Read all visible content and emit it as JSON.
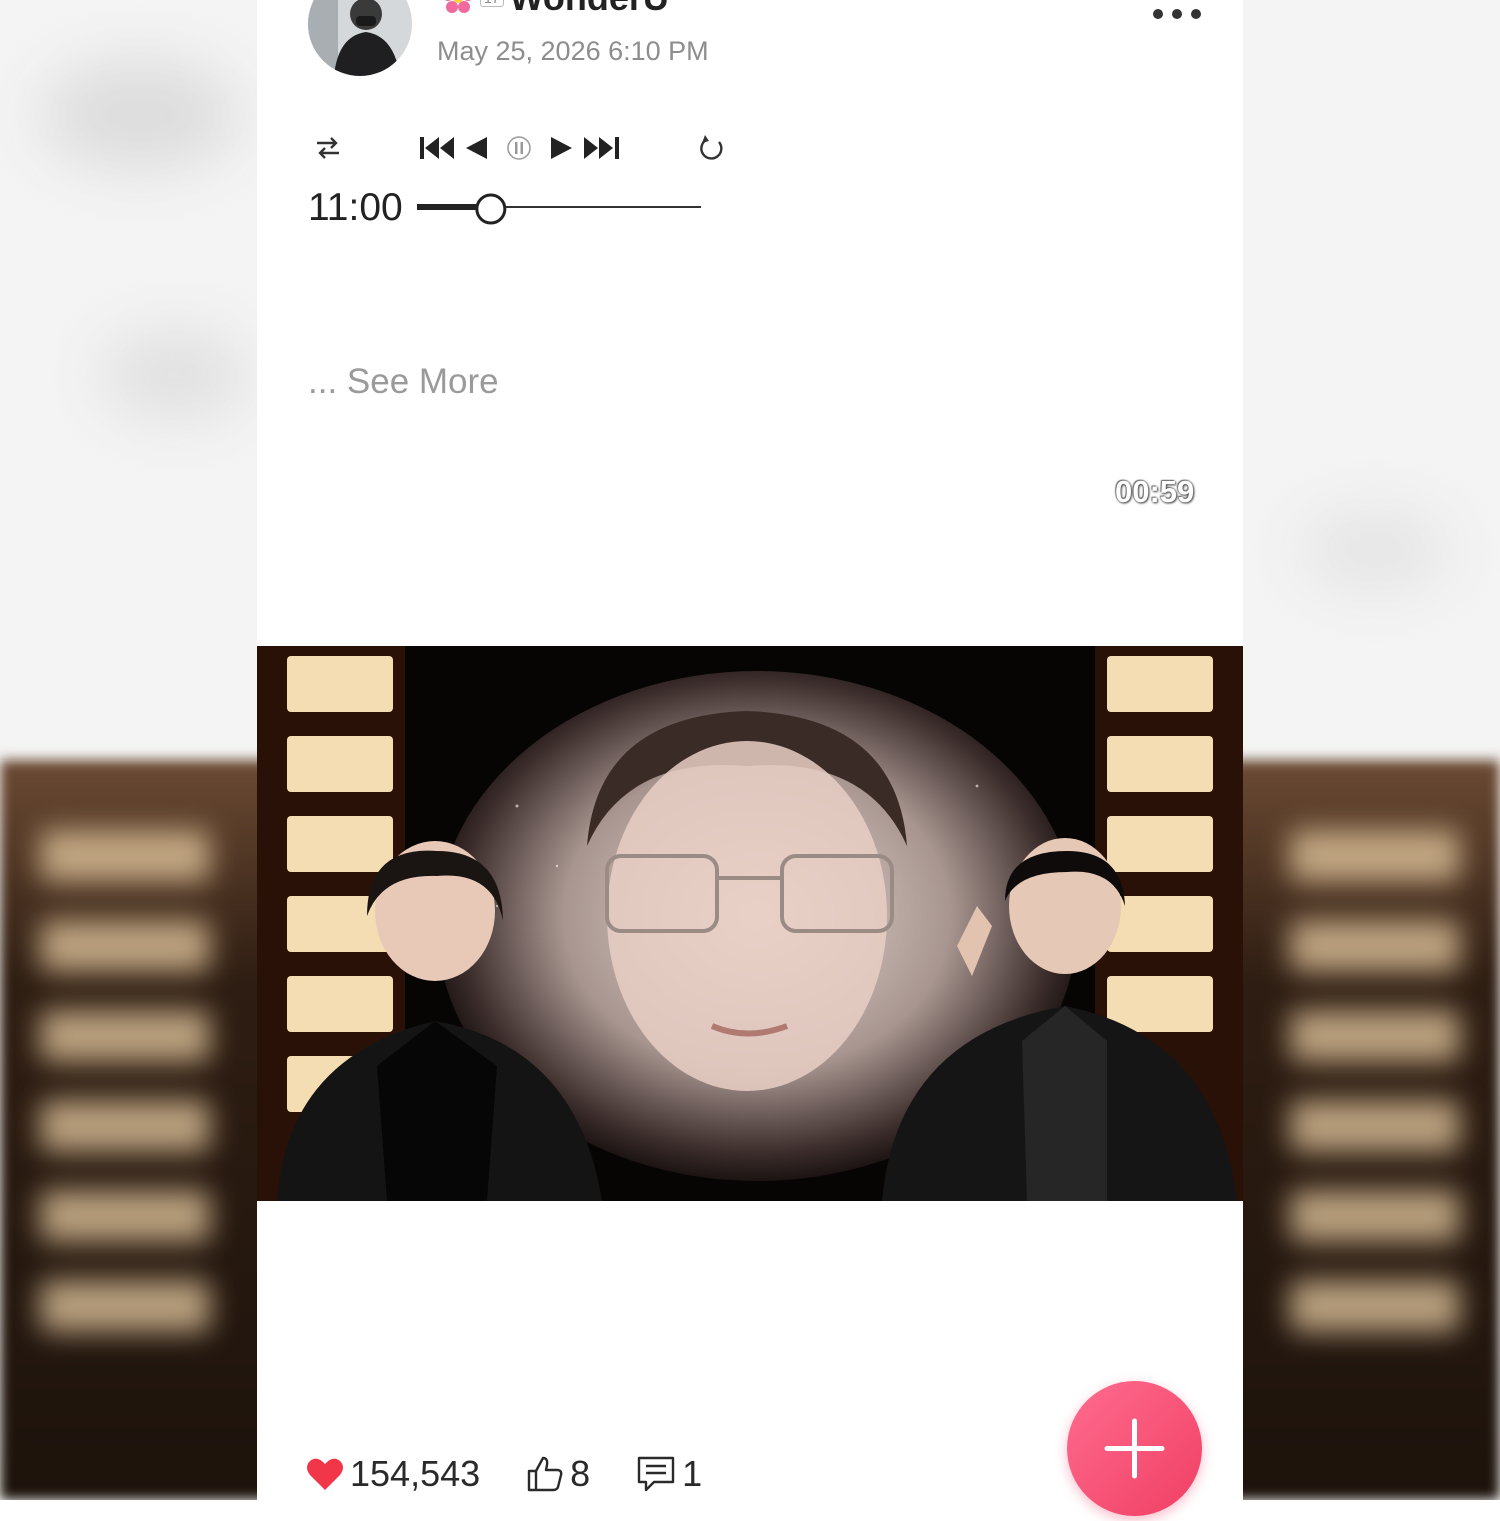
{
  "post": {
    "username": "WonderU",
    "level": "17",
    "date": "May 25, 2026 6:10 PM",
    "see_more": "... See More"
  },
  "player": {
    "shuffle_icon": "shuffle-icon",
    "prev_icon": "skip-previous-icon",
    "rewind_icon": "rewind-icon",
    "pause_icon": "pause-icon",
    "play_icon": "play-icon",
    "next_icon": "skip-next-icon",
    "repeat_icon": "repeat-icon",
    "time": "11:00",
    "progress": 0.26
  },
  "video": {
    "duration": "00:59"
  },
  "stats": {
    "hearts": "154,543",
    "likes": "8",
    "comments": "1"
  },
  "colors": {
    "accent": "#f0456a",
    "heart": "#f2364a"
  }
}
